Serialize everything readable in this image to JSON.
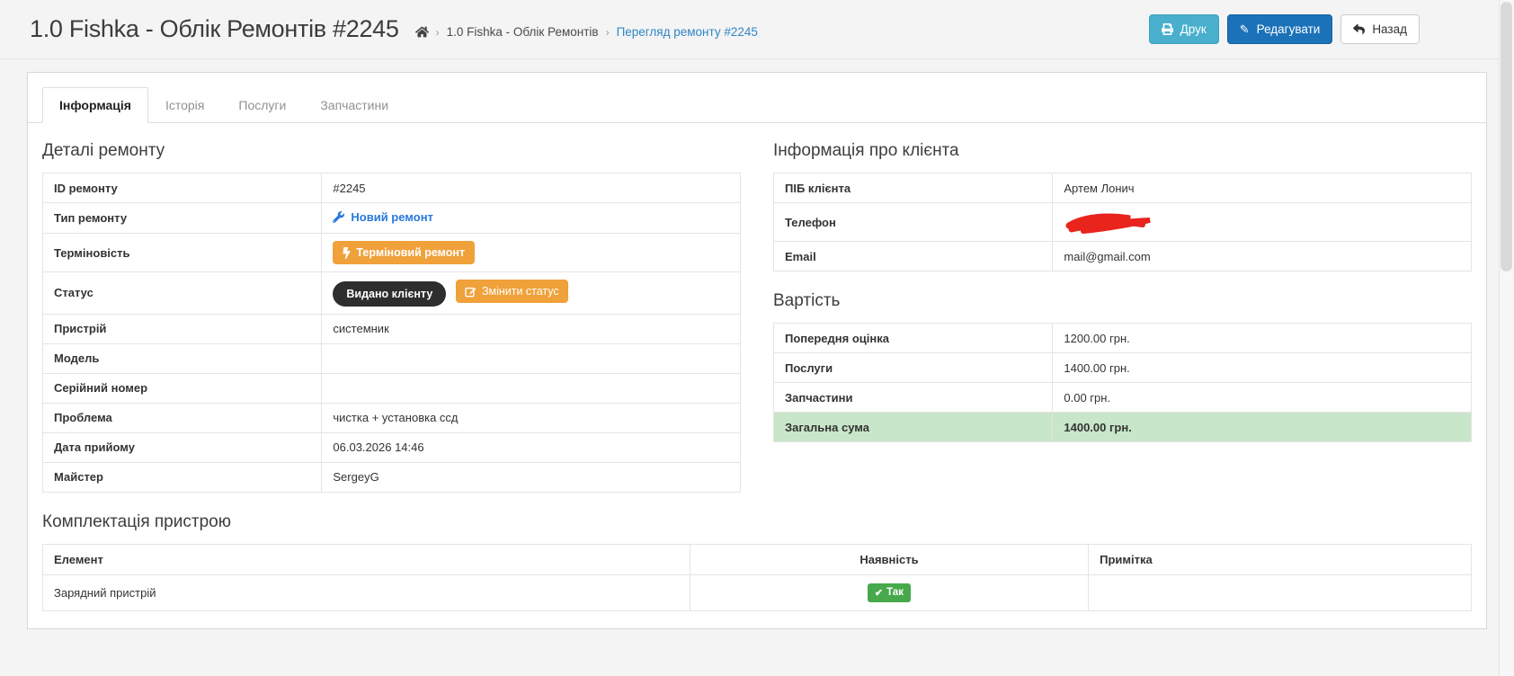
{
  "header": {
    "title": "1.0 Fishka - Облік Ремонтів #2245",
    "breadcrumb": {
      "separator": "›",
      "parent": "1.0 Fishka - Облік Ремонтів",
      "current": "Перегляд ремонту #2245"
    },
    "buttons": {
      "print": "Друк",
      "edit": "Редагувати",
      "back": "Назад"
    }
  },
  "tabs": [
    {
      "label": "Інформація",
      "active": true
    },
    {
      "label": "Історія",
      "active": false
    },
    {
      "label": "Послуги",
      "active": false
    },
    {
      "label": "Запчастини",
      "active": false
    }
  ],
  "details": {
    "heading": "Деталі ремонту",
    "rows": {
      "id": {
        "label": "ID ремонту",
        "value": "#2245"
      },
      "type": {
        "label": "Тип ремонту",
        "value": "Новий ремонт"
      },
      "urgency": {
        "label": "Терміновість",
        "badge": "Терміновий ремонт"
      },
      "status": {
        "label": "Статус",
        "badge": "Видано клієнту",
        "change_button": "Змінити статус"
      },
      "device": {
        "label": "Пристрій",
        "value": "системник"
      },
      "model": {
        "label": "Модель",
        "value": ""
      },
      "serial": {
        "label": "Серійний номер",
        "value": ""
      },
      "problem": {
        "label": "Проблема",
        "value": "чистка + установка ссд"
      },
      "date": {
        "label": "Дата прийому",
        "value": "06.03.2026 14:46"
      },
      "master": {
        "label": "Майстер",
        "value": "SergeyG"
      }
    }
  },
  "client": {
    "heading": "Інформація про клієнта",
    "rows": {
      "name": {
        "label": "ПІБ клієнта",
        "value": "Артем Лонич"
      },
      "phone": {
        "label": "Телефон",
        "redacted": true
      },
      "email": {
        "label": "Email",
        "value": "mail@gmail.com"
      }
    }
  },
  "cost": {
    "heading": "Вартість",
    "rows": {
      "estimate": {
        "label": "Попередня оцінка",
        "value": "1200.00 грн."
      },
      "services": {
        "label": "Послуги",
        "value": "1400.00 грн."
      },
      "parts": {
        "label": "Запчастини",
        "value": "0.00 грн."
      },
      "total": {
        "label": "Загальна сума",
        "value": "1400.00 грн."
      }
    }
  },
  "equipment": {
    "heading": "Комплектація пристрою",
    "columns": {
      "element": "Елемент",
      "availability": "Наявність",
      "note": "Примітка"
    },
    "rows": [
      {
        "element": "Зарядний пристрій",
        "availability": "Так",
        "note": ""
      }
    ]
  },
  "icons": {
    "home": "home-icon",
    "printer": "printer-icon",
    "pencil_glyph": "✎",
    "back": "reply-arrow-icon",
    "wrench": "wrench-icon",
    "bolt": "lightning-bolt-icon",
    "edit_square": "edit-square-icon",
    "check_glyph": "✔",
    "redaction": "red-marker-scribble"
  },
  "colors": {
    "primary_blue": "#1b72b8",
    "info_blue": "#49afcd",
    "link_blue": "#2e86c5",
    "type_link_blue": "#2879dd",
    "orange": "#f0a13a",
    "dark_badge": "#2e2e2e",
    "green_badge": "#47a94c",
    "total_row_bg": "#c8e6c9",
    "redaction_red": "#e8241d"
  }
}
